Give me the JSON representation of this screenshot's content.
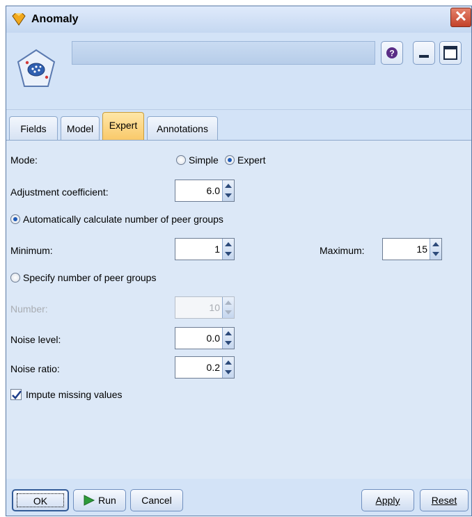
{
  "window": {
    "title": "Anomaly"
  },
  "header": {
    "node_name": ""
  },
  "tabs": [
    {
      "label": "Fields"
    },
    {
      "label": "Model"
    },
    {
      "label": "Expert"
    },
    {
      "label": "Annotations"
    }
  ],
  "expert": {
    "mode_label": "Mode:",
    "mode_options": [
      "Simple",
      "Expert"
    ],
    "mode_selected": "Expert",
    "adjustment_label": "Adjustment coefficient:",
    "adjustment_value": "6.0",
    "auto_peer_label": "Automatically calculate number of peer groups",
    "minimum_label": "Minimum:",
    "minimum_value": "1",
    "maximum_label": "Maximum:",
    "maximum_value": "15",
    "specify_peer_label": "Specify number of peer groups",
    "number_label": "Number:",
    "number_value": "10",
    "noise_level_label": "Noise level:",
    "noise_level_value": "0.0",
    "noise_ratio_label": "Noise ratio:",
    "noise_ratio_value": "0.2",
    "impute_label": "Impute missing values",
    "impute_checked": true
  },
  "footer": {
    "ok_label": "OK",
    "run_label": "Run",
    "cancel_label": "Cancel",
    "apply_label": "Apply",
    "reset_label": "Reset"
  },
  "colors": {
    "active_tab": "#f9c96a",
    "panel_bg": "#dce8f7",
    "close_button": "#c3422a"
  },
  "icons": [
    "node-icon",
    "help-icon",
    "minimize-icon",
    "maximize-icon",
    "close-icon",
    "run-icon",
    "checkmark-icon"
  ]
}
